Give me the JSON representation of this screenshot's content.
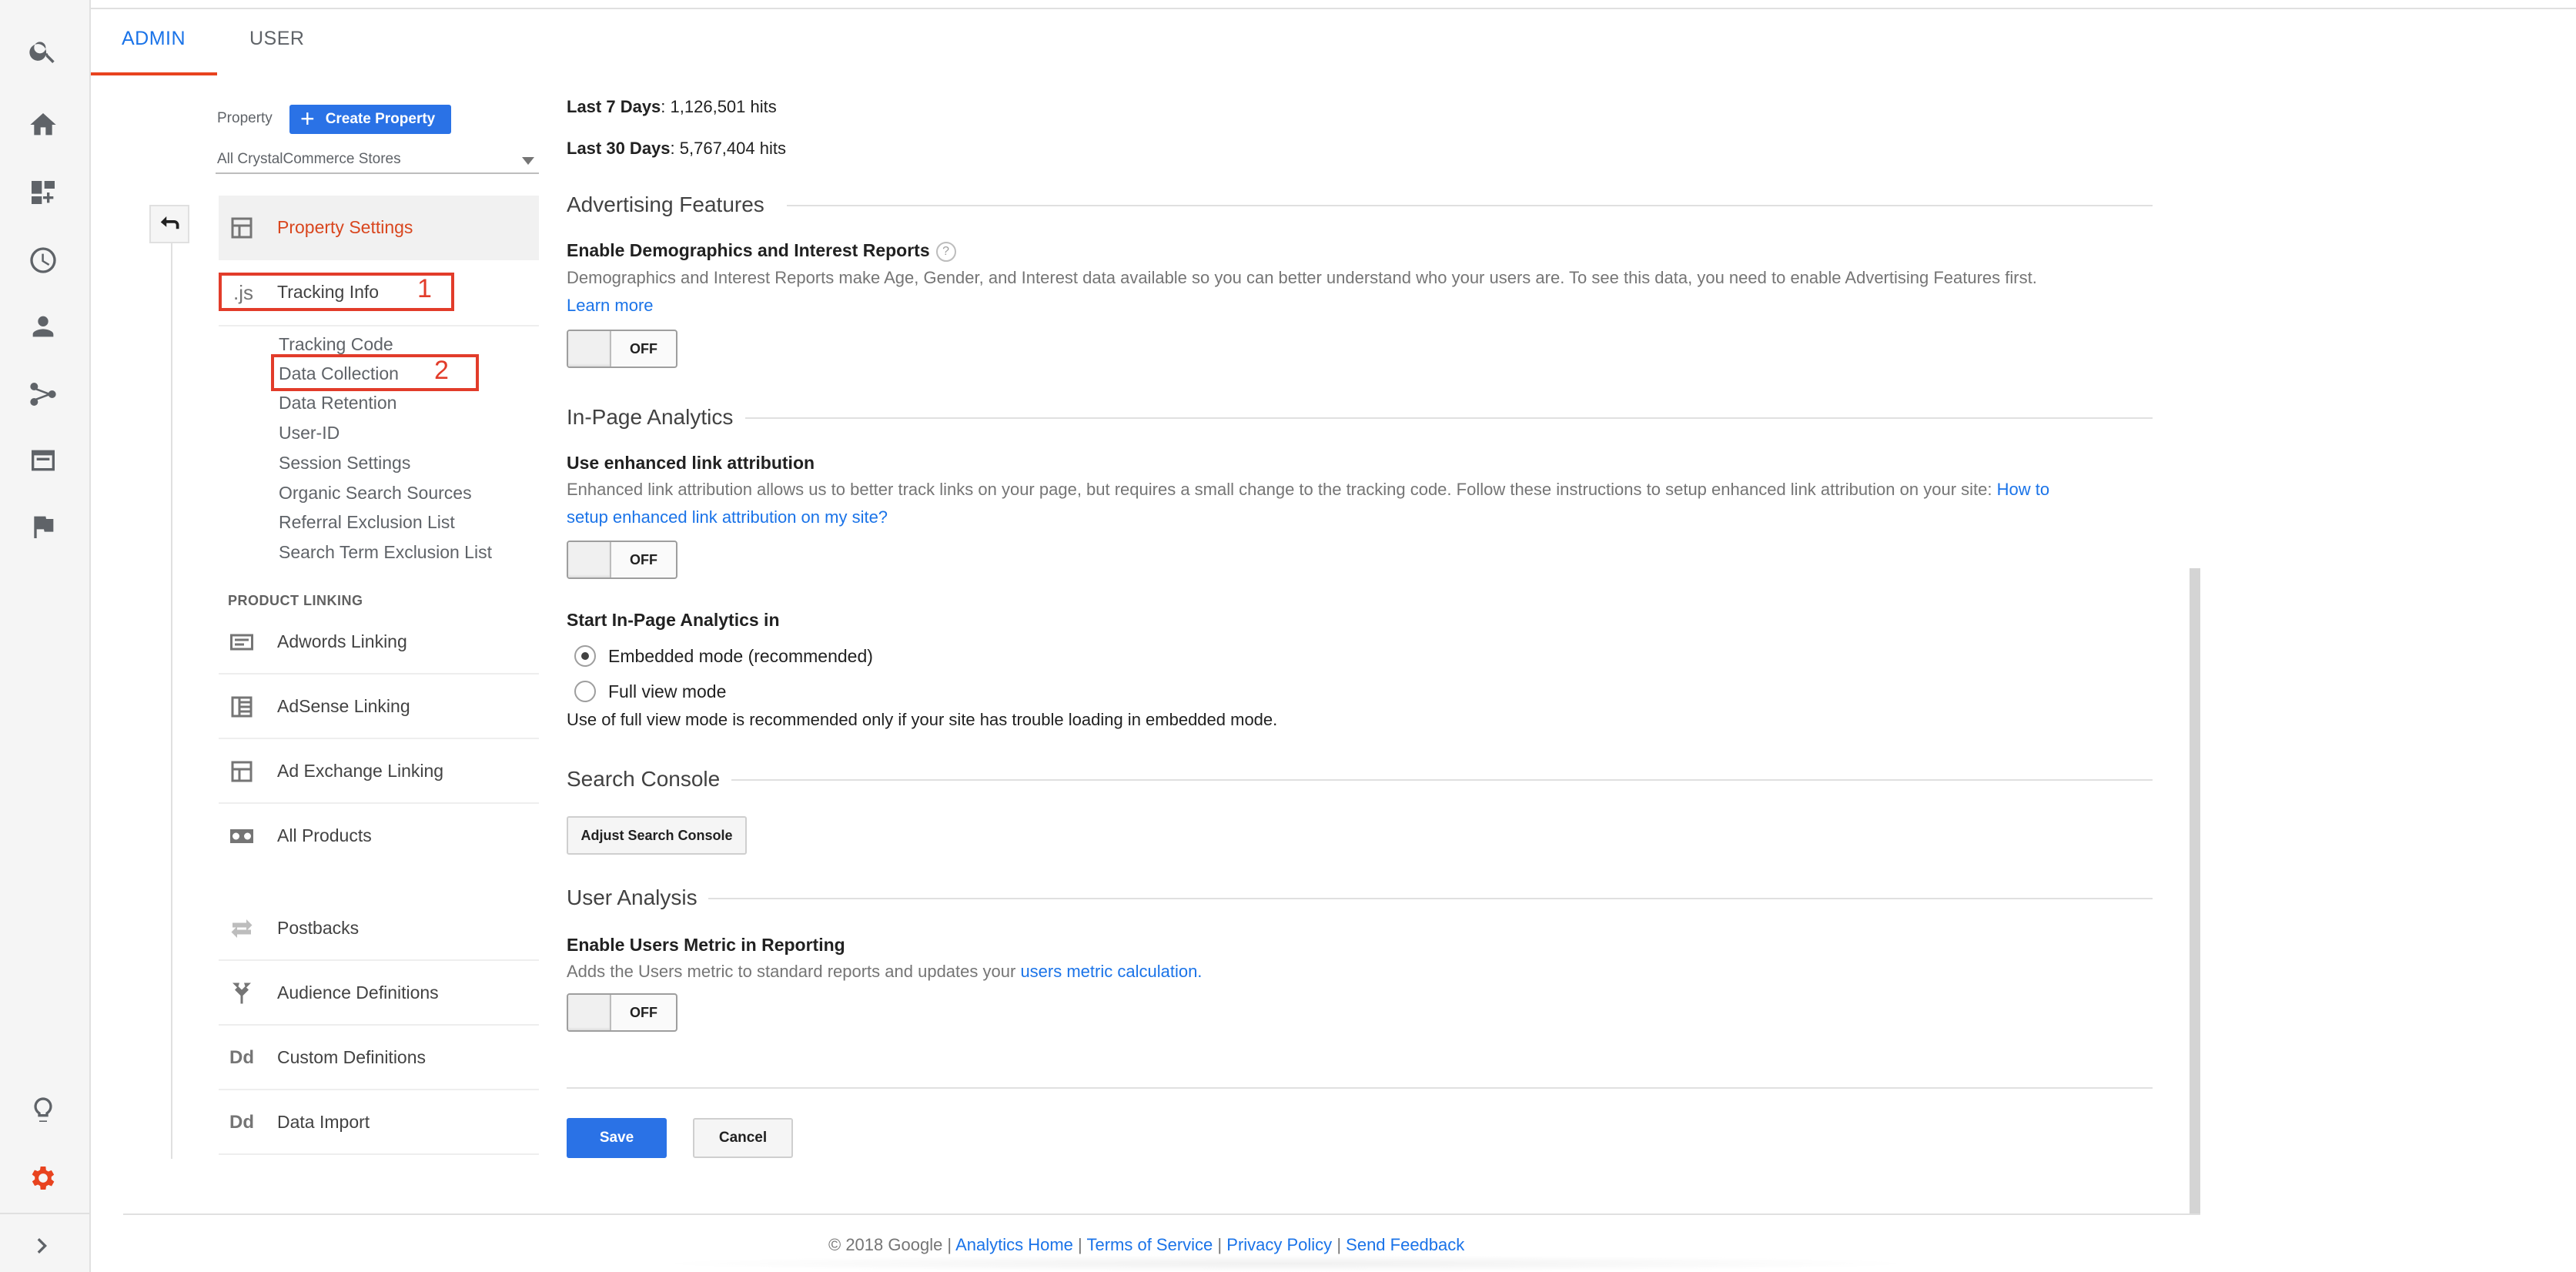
{
  "tabs": {
    "admin": "ADMIN",
    "user": "USER"
  },
  "property": {
    "label": "Property",
    "create_button": "Create Property",
    "selected": "All CrystalCommerce Stores"
  },
  "nav": {
    "property_settings": "Property Settings",
    "tracking_info": "Tracking Info",
    "tracking_icon": ".js",
    "sub_items": [
      "Tracking Code",
      "Data Collection",
      "Data Retention",
      "User-ID",
      "Session Settings",
      "Organic Search Sources",
      "Referral Exclusion List",
      "Search Term Exclusion List"
    ],
    "product_linking_header": "PRODUCT LINKING",
    "links": [
      "Adwords Linking",
      "AdSense Linking",
      "Ad Exchange Linking",
      "All Products",
      "Postbacks",
      "Audience Definitions",
      "Custom Definitions",
      "Data Import"
    ],
    "custom_icon": "Dd",
    "import_icon": "Dd"
  },
  "annotations": {
    "one": "1",
    "two": "2"
  },
  "stats": {
    "last7_label": "Last 7 Days",
    "last7_value": ": 1,126,501 hits",
    "last30_label": "Last 30 Days",
    "last30_value": ": 5,767,404 hits"
  },
  "advertising": {
    "heading": "Advertising Features",
    "title": "Enable Demographics and Interest Reports",
    "help": "?",
    "desc": "Demographics and Interest Reports make Age, Gender, and Interest data available so you can better understand who your users are. To see this data, you need to enable Advertising Features first.",
    "learn_more": "Learn more",
    "toggle": "OFF"
  },
  "inpage": {
    "heading": "In-Page Analytics",
    "title": "Use enhanced link attribution",
    "desc": "Enhanced link attribution allows us to better track links on your page, but requires a small change to the tracking code. Follow these instructions to setup enhanced link attribution on your site:",
    "link_part1": "How to",
    "link_part2": "setup enhanced link attribution on my site?",
    "toggle": "OFF",
    "start_title": "Start In-Page Analytics in",
    "option_embedded": "Embedded mode (recommended)",
    "option_full": "Full view mode",
    "note": "Use of full view mode is recommended only if your site has trouble loading in embedded mode."
  },
  "search_console": {
    "heading": "Search Console",
    "button": "Adjust Search Console"
  },
  "user_analysis": {
    "heading": "User Analysis",
    "title": "Enable Users Metric in Reporting",
    "desc": "Adds the Users metric to standard reports and updates your",
    "link": "users metric calculation.",
    "toggle": "OFF"
  },
  "actions": {
    "save": "Save",
    "cancel": "Cancel"
  },
  "footer": {
    "copyright": "© 2018 Google |",
    "analytics_home": "Analytics Home",
    "terms": "Terms of Service",
    "privacy": "Privacy Policy",
    "feedback": "Send Feedback",
    "sep": "|"
  },
  "colors": {
    "accent": "#1a73e8",
    "active": "#d9461e",
    "highlight": "#e23c2a",
    "button": "#2a72e6"
  },
  "icons": [
    "search-icon",
    "home-icon",
    "dashboard-icon",
    "clock-icon",
    "person-icon",
    "acquisition-icon",
    "behavior-icon",
    "flag-icon",
    "lightbulb-icon",
    "gear-icon",
    "chevron-right-icon"
  ]
}
